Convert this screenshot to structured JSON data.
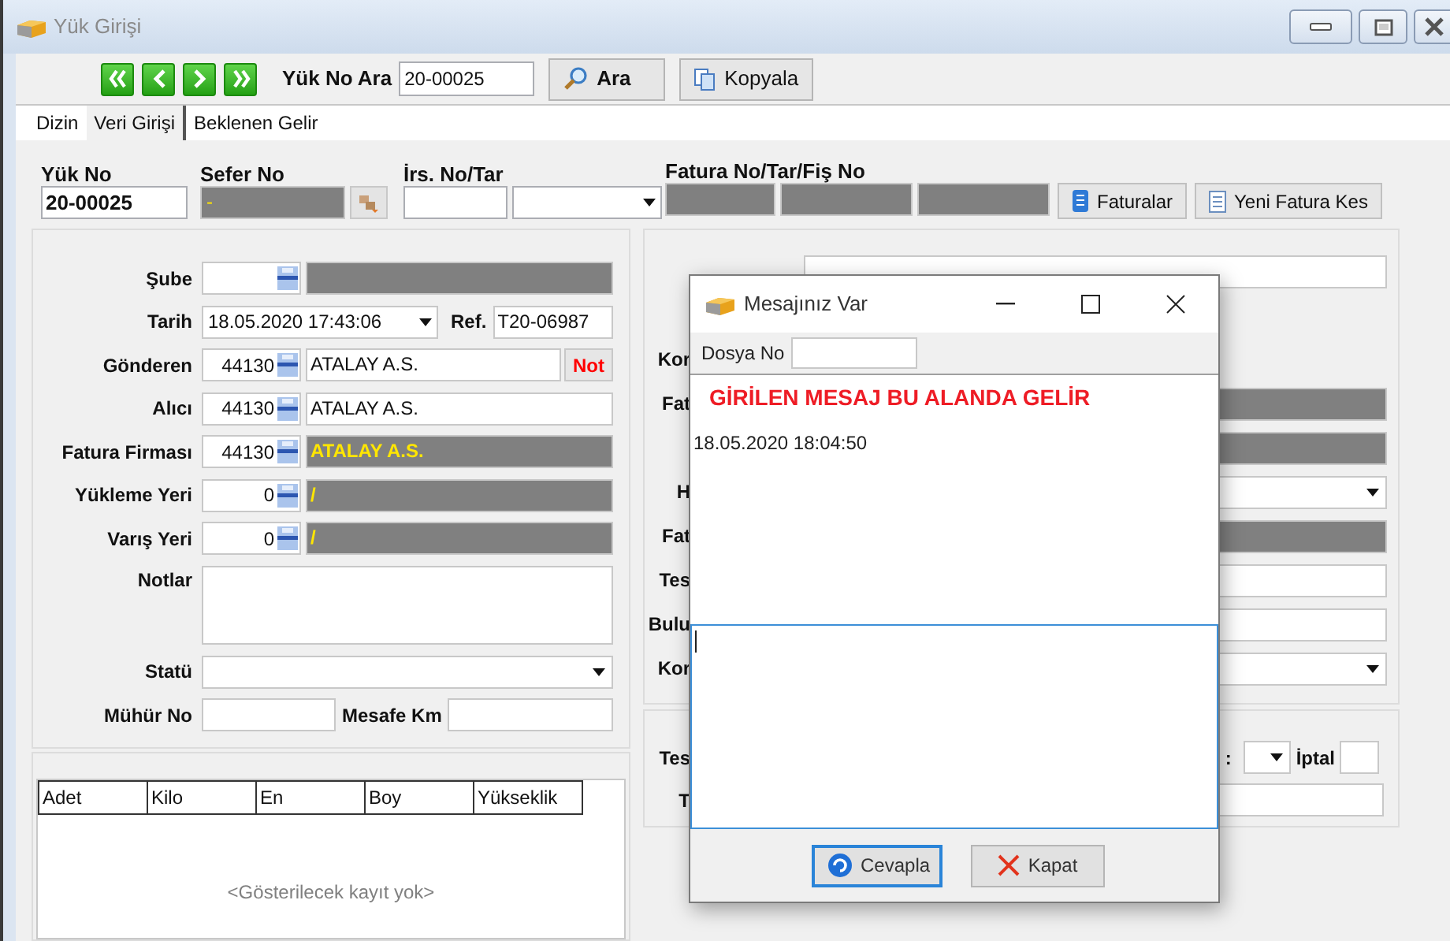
{
  "window": {
    "title": "Yük Girişi"
  },
  "toolbar": {
    "search_label": "Yük No Ara",
    "search_value": "20-00025",
    "buttons": [
      {
        "label": "Ara",
        "kind": "search"
      },
      {
        "label": "Kopyala",
        "kind": "copy"
      }
    ]
  },
  "tabs": [
    {
      "label": "Dizin",
      "selected": false
    },
    {
      "label": "Veri Girişi",
      "selected": true
    },
    {
      "label": "Beklenen Gelir",
      "selected": false
    }
  ],
  "header": {
    "yuk_no": {
      "label": "Yük No",
      "value": "20-00025"
    },
    "sefer_no": {
      "label": "Sefer No",
      "value": "-"
    },
    "irs_label": "İrs. No/Tar",
    "fatura_label": "Fatura No/Tar/Fiş No",
    "buttons": [
      {
        "label": "Faturalar",
        "kind": "invoices"
      },
      {
        "label": "Yeni Fatura Kes",
        "kind": "new"
      }
    ]
  },
  "form": [
    {
      "kind": "lookup",
      "label": "Şube",
      "readonly": true
    },
    {
      "kind": "date",
      "label": "Tarih",
      "value": "18.05.2020 17:43:06",
      "ref_label": "Ref.",
      "ref_value": "T20-06987"
    },
    {
      "kind": "lookup",
      "label": "Gönderen",
      "code": "44130",
      "name": "ATALAY A.S.",
      "readonly": false,
      "note_button": "Not"
    },
    {
      "kind": "lookup",
      "label": "Alıcı",
      "code": "44130",
      "name": "ATALAY A.S.",
      "readonly": false
    },
    {
      "kind": "lookup",
      "label": "Fatura Firması",
      "code": "44130",
      "name": "ATALAY A.S.",
      "readonly": true
    },
    {
      "kind": "lookup",
      "label": "Yükleme Yeri",
      "code": "0",
      "name": "/",
      "readonly": true
    },
    {
      "kind": "lookup",
      "label": "Varış Yeri",
      "code": "0",
      "name": "/",
      "readonly": true
    },
    {
      "kind": "notes",
      "label": "Notlar"
    },
    {
      "kind": "select",
      "label": "Statü"
    },
    {
      "kind": "pair",
      "label": "Mühür No",
      "label2": "Mesafe Km"
    }
  ],
  "table": {
    "columns": [
      "Adet",
      "Kilo",
      "En",
      "Boy",
      "Yükseklik"
    ],
    "empty_text": "<Gösterilecek kayıt yok>"
  },
  "right_panel": {
    "rows": [
      {
        "label": "Kor",
        "kind": "blank"
      },
      {
        "label": "Fat",
        "kind": "readonly"
      },
      {
        "kind": "readonly"
      },
      {
        "label": "H",
        "kind": "select"
      },
      {
        "label": "Fat",
        "kind": "readonly"
      },
      {
        "label": "Tes",
        "kind": "text"
      },
      {
        "label": "Bulu",
        "kind": "text"
      },
      {
        "label": "Kor",
        "kind": "select"
      }
    ]
  },
  "right_bottom": {
    "rows": [
      {
        "label": "Tes",
        "kind": "cancel",
        "colon": ":",
        "cancel_label": "İptal"
      },
      {
        "label": "T",
        "kind": "text"
      }
    ]
  },
  "dialog": {
    "title": "Mesajınız Var",
    "dosya_label": "Dosya No",
    "message": "GİRİLEN MESAJ BU ALANDA GELİR",
    "timestamp": "18.05.2020 18:04:50",
    "buttons": [
      {
        "label": "Cevapla",
        "kind": "reply",
        "focused": true
      },
      {
        "label": "Kapat",
        "kind": "close",
        "focused": false
      }
    ]
  }
}
